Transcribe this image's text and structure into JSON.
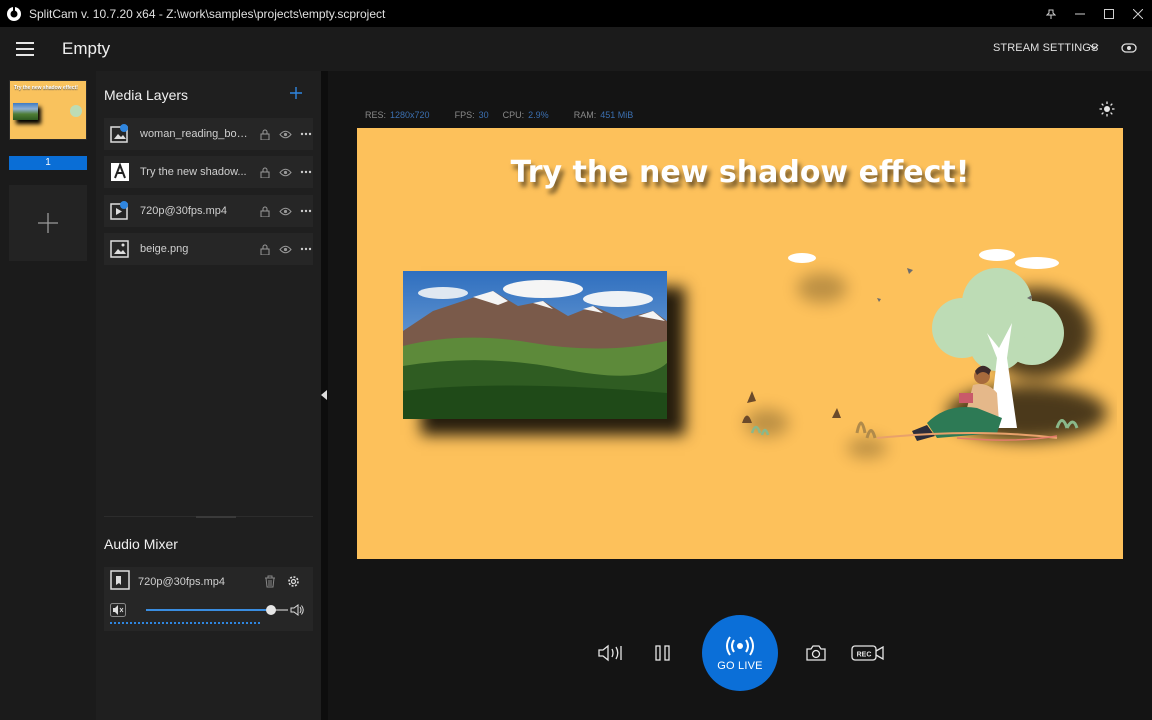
{
  "window": {
    "title": "SplitCam v. 10.7.20 x64 - Z:\\work\\samples\\projects\\empty.scproject"
  },
  "header": {
    "project_name": "Empty",
    "stream_settings_label": "STREAM SETTINGS"
  },
  "scenes": {
    "items": [
      {
        "number": "1",
        "thumbnail_text": "Try the new shadow effect!"
      }
    ]
  },
  "media_layers": {
    "title": "Media Layers",
    "items": [
      {
        "name": "woman_reading_boo...",
        "type": "image-sequence"
      },
      {
        "name": "Try the new shadow...",
        "type": "text"
      },
      {
        "name": "720p@30fps.mp4",
        "type": "video"
      },
      {
        "name": "beige.png",
        "type": "image"
      }
    ]
  },
  "audio_mixer": {
    "title": "Audio Mixer",
    "items": [
      {
        "name": "720p@30fps.mp4",
        "volume_fraction": 0.85
      }
    ]
  },
  "stats": {
    "res_label": "RES:",
    "res_value": "1280x720",
    "fps_label": "FPS:",
    "fps_value": "30",
    "cpu_label": "CPU:",
    "cpu_value": "2.9%",
    "ram_label": "RAM:",
    "ram_value": "451 MiB"
  },
  "preview": {
    "headline": "Try the new shadow effect!",
    "background_color": "#fdc15b"
  },
  "controls": {
    "go_live_label": "GO LIVE",
    "rec_badge": "REC"
  },
  "colors": {
    "accent": "#0b6fd8",
    "panel": "#1f1f1f",
    "canvas_bg": "#fdc15b"
  }
}
